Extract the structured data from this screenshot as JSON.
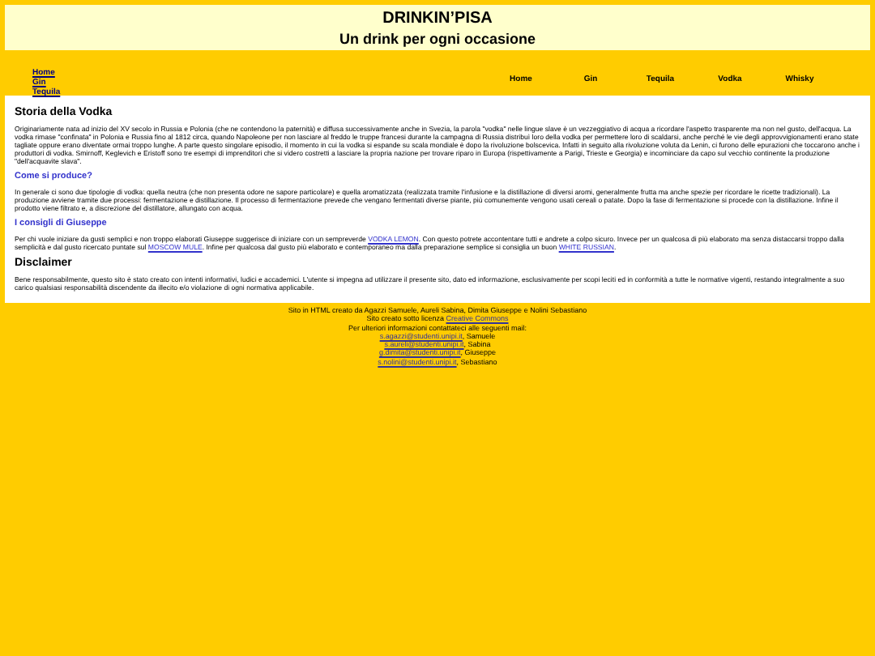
{
  "header": {
    "title": "DRINKIN’PISA",
    "subtitle": "Un drink per ogni occasione"
  },
  "side_links": [
    "Home",
    "Gin",
    "Tequila"
  ],
  "menu": [
    "Home",
    "Gin",
    "Tequila",
    "Vodka",
    "Whisky"
  ],
  "sections": [
    {
      "kind": "h2",
      "heading": "Storia della Vodka",
      "parts": [
        {
          "text": "Originariamente nata ad inizio del XV secolo in Russia e Polonia (che ne contendono la paternità) e diffusa successivamente anche in Svezia, la parola \"vodka\" nelle lingue slave è un vezzeggiativo di acqua a ricordare l'aspetto trasparente ma non nel gusto, dell'acqua. La vodka rimase \"confinata\" in Polonia e Russia fino al 1812 circa, quando Napoleone per non lasciare al freddo le truppe francesi durante la campagna di Russia distribuì loro della vodka per permettere loro di scaldarsi, anche perché le vie degli approvvigionamenti erano state tagliate oppure erano diventate ormai troppo lunghe. A parte questo singolare episodio, il momento in cui la vodka si espande su scala mondiale è dopo la rivoluzione bolscevica. Infatti in seguito alla rivoluzione voluta da Lenin, ci furono delle epurazioni che toccarono anche i produttori di vodka. Smirnoff, Keglevich e Eristoff sono tre esempi di imprenditori che si videro costretti a lasciare la propria nazione per trovare riparo in Europa (rispettivamente a Parigi, Trieste e Georgia) e incominciare da capo sul vecchio continente la produzione \"dell'acquavite slava\"."
        }
      ]
    },
    {
      "kind": "h3",
      "heading": "Come si produce?",
      "parts": [
        {
          "text": "In generale ci sono due tipologie di vodka: quella neutra (che non presenta odore ne sapore particolare) e quella aromatizzata (realizzata tramite l'infusione e la distillazione di diversi aromi, generalmente frutta ma anche spezie per ricordare le ricette tradizionali). La produzione avviene tramite due processi: fermentazione e distillazione. Il processo di fermentazione prevede che vengano fermentati diverse piante, più comunemente vengono usati cereali o patate. Dopo la fase di fermentazione si procede con la distillazione. Infine il prodotto viene filtrato e, a discrezione del distillatore, allungato con acqua."
        }
      ]
    },
    {
      "kind": "h3",
      "heading": "I consigli di Giuseppe",
      "parts": [
        {
          "text": "Per chi vuole iniziare da gusti semplici e non troppo elaborati Giuseppe suggerisce di iniziare con un sempreverde "
        },
        {
          "link": "VODKA LEMON"
        },
        {
          "text": ". Con questo potrete accontentare tutti e andrete a colpo sicuro. Invece per un qualcosa di più elaborato ma senza distaccarsi troppo dalla semplicità e dal gusto ricercato puntate sul "
        },
        {
          "link": "MOSCOW MULE"
        },
        {
          "text": ". Infine per qualcosa dal gusto più elaborato e contemporaneo ma dalla preparazione semplice si consiglia un buon "
        },
        {
          "link": "WHITE RUSSIAN"
        },
        {
          "text": "."
        }
      ]
    },
    {
      "kind": "h2",
      "heading": "Disclaimer",
      "parts": [
        {
          "text": "Bene responsabilmente, questo sito è stato creato con intenti informativi, ludici e accademici. L'utente si impegna ad utilizzare il presente sito, dato ed informazione, esclusivamente per scopi leciti ed in conformità a tutte le normative vigenti, restando integralmente a suo carico qualsiasi responsabilità discendente da illecito e/o violazione di ogni normativa applicabile."
        }
      ]
    }
  ],
  "footer": {
    "credits": "Sito in HTML creato da Agazzi Samuele, Aureli Sabina, Dimita Giuseppe e Nolini Sebastiano",
    "license_text": "Sito creato sotto licenza",
    "license_link": "Creative Commons",
    "contact": "Per ulteriori informazioni contattateci alle seguenti mail:",
    "emails": [
      {
        "email": "s.agazzi@studenti.unipi.it",
        "name": ", Samuele"
      },
      {
        "email": "s.aureli@studenti.unipi.it",
        "name": ", Sabina"
      },
      {
        "email": "g.dimita@studenti.unipi.it",
        "name": ", Giuseppe"
      },
      {
        "email": "s.nolini@studenti.unipi.it",
        "name": ", Sebastiano"
      }
    ]
  }
}
